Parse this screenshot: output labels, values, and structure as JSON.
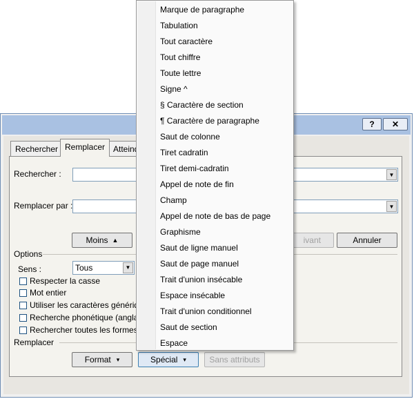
{
  "window": {
    "help_label": "?",
    "close_label": "✕"
  },
  "tabs": [
    {
      "label": "Rechercher"
    },
    {
      "label": "Remplacer"
    },
    {
      "label": "Atteind"
    }
  ],
  "find": {
    "label": "Rechercher :",
    "value": ""
  },
  "replace": {
    "label": "Remplacer par :",
    "value": ""
  },
  "buttons": {
    "moins": "Moins",
    "moins_icon": "▲",
    "suivant": "ivant",
    "annuler": "Annuler",
    "format": "Format",
    "special": "Spécial",
    "sans_attributs": "Sans attributs",
    "dropdown_icon": "▾",
    "combo_arrow": "▼"
  },
  "options": {
    "title": "Options",
    "sens_label": "Sens :",
    "sens_value": "Tous",
    "checkboxes": [
      {
        "label": "Respecter la casse",
        "checked": false
      },
      {
        "label": "Mot entier",
        "checked": false
      },
      {
        "label": "Utiliser les caractères génériques",
        "checked": false
      },
      {
        "label": "Recherche phonétique (anglais)",
        "checked": false
      },
      {
        "label": "Rechercher toutes les formes du",
        "checked": false
      }
    ],
    "replace_section": "Remplacer"
  },
  "special_menu": [
    "Marque de paragraphe",
    "Tabulation",
    "Tout caractère",
    "Tout chiffre",
    "Toute lettre",
    "Signe ^",
    "§ Caractère de section",
    "¶ Caractère de paragraphe",
    "Saut de colonne",
    "Tiret cadratin",
    "Tiret demi-cadratin",
    "Appel de note de fin",
    "Champ",
    "Appel de note de bas de page",
    "Graphisme",
    "Saut de ligne manuel",
    "Saut de page manuel",
    "Trait d'union insécable",
    "Espace insécable",
    "Trait d'union conditionnel",
    "Saut de section",
    "Espace"
  ]
}
